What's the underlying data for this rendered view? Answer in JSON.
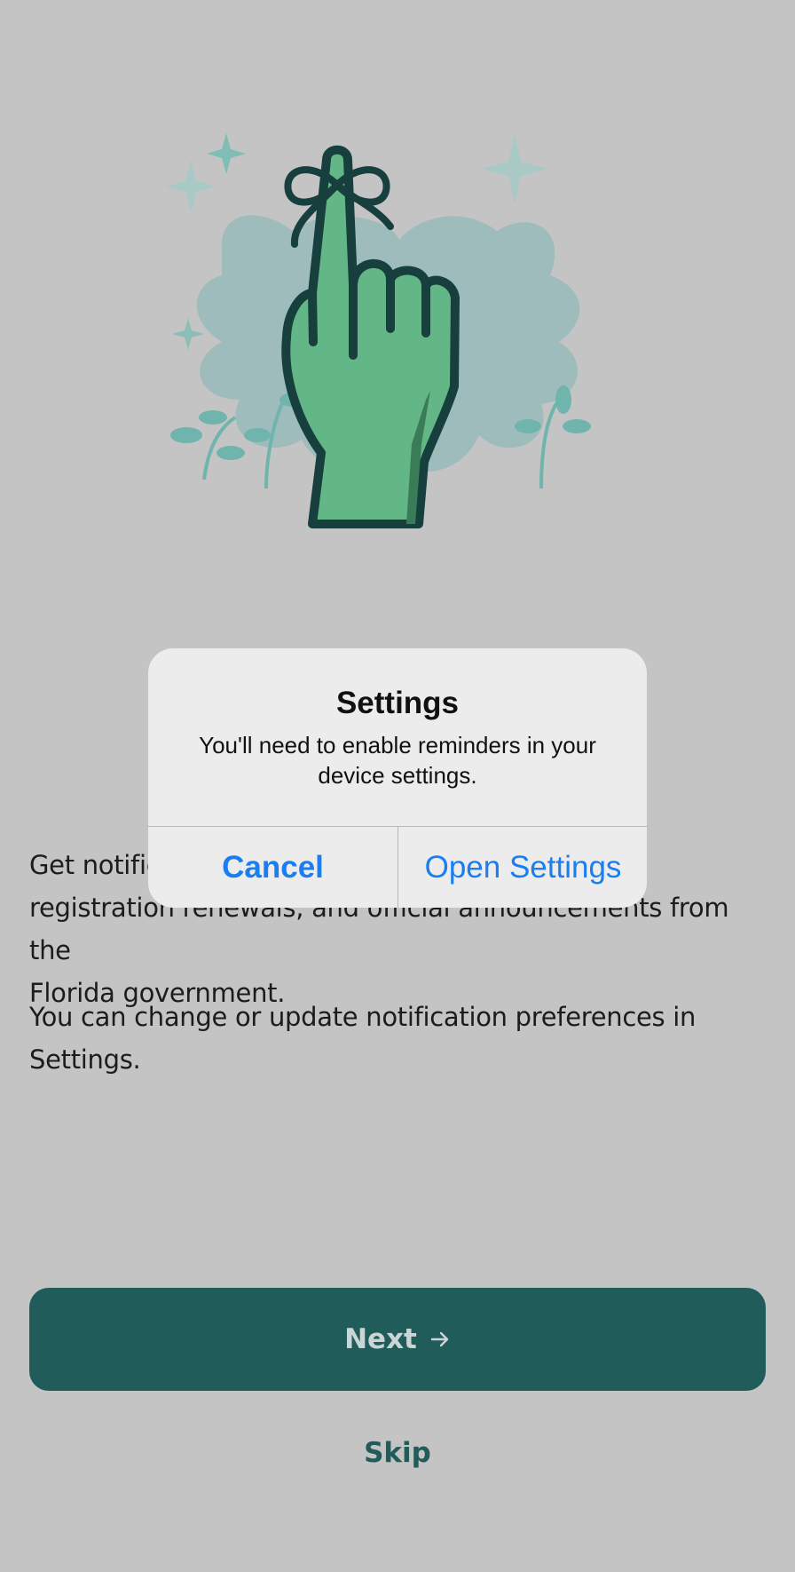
{
  "colors": {
    "background": "#c4c4c4",
    "primary": "#1f5c5a",
    "dialog_button": "#1a7ef0",
    "hand_green": "#63b685"
  },
  "illustration": {
    "icon": "finger-with-ribbon-reminder-icon"
  },
  "body": {
    "p1_line1": "Get notifie",
    "p1_line2": "registration renewals, and official announcements from the",
    "p1_line3": "Florida government.",
    "p2": "You can change or update notification preferences in Settings."
  },
  "buttons": {
    "next_label": "Next",
    "next_icon": "arrow-right-icon",
    "skip_label": "Skip"
  },
  "dialog": {
    "title": "Settings",
    "message": "You'll need to enable reminders in your device settings.",
    "cancel_label": "Cancel",
    "open_label": "Open Settings"
  }
}
